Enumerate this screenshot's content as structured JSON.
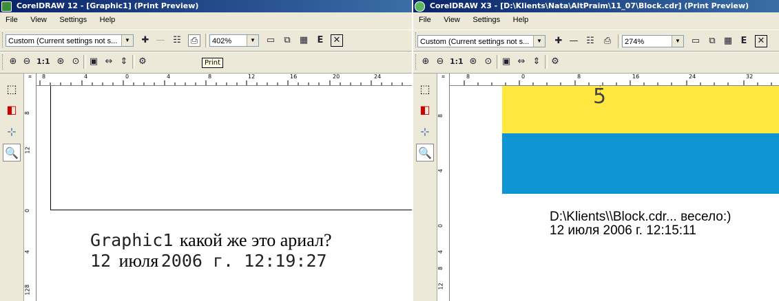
{
  "left": {
    "title": "CorelDRAW 12 - [Graphic1] (Print Preview)",
    "menu": [
      "File",
      "View",
      "Settings",
      "Help"
    ],
    "preset": "Custom (Current settings not s...",
    "zoom": "402%",
    "tooltip": "Print",
    "hruler_labels": [
      "8",
      "4",
      "0",
      "4",
      "8",
      "12",
      "16",
      "20",
      "24"
    ],
    "vruler_labels": [
      "8",
      "12",
      "0",
      "4",
      "8",
      "12"
    ],
    "footer_name": "Graphic1",
    "footer_comment": "какой же это ариал?",
    "footer_date_a": "12",
    "footer_date_b": "июля",
    "footer_date_c": "2006 г. 12:19:27"
  },
  "right": {
    "title": "CorelDRAW X3 - [D:\\Klients\\Nata\\AltPraim\\11_07\\Block.cdr] (Print Preview)",
    "menu": [
      "File",
      "View",
      "Settings",
      "Help"
    ],
    "preset": "Custom (Current settings not s...",
    "zoom": "274%",
    "hruler_labels": [
      "8",
      "0",
      "8",
      "16",
      "24",
      "32"
    ],
    "vruler_labels": [
      "8",
      "4",
      "0",
      "4",
      "8",
      "12"
    ],
    "marker": "5",
    "footer_line1": "D:\\Klients\\\\Block.cdr... весело:)",
    "footer_line2": "12 июля 2006 г. 12:15:11",
    "colors": {
      "yellow": "#ffe840",
      "blue": "#0f94d4"
    }
  },
  "icons": {
    "toolbar1": [
      "plus-icon",
      "minus-icon",
      "layout-icon",
      "print-icon",
      "save-icon",
      "copy-icon",
      "film-icon",
      "e-icon",
      "close-box-icon"
    ],
    "toolbar2": [
      "zoom-in-icon",
      "zoom-out-icon",
      "actual-size-icon",
      "zoom-all-icon",
      "zoom-selection-icon",
      "page-icon",
      "fit-width-icon",
      "fit-height-icon",
      "zoom-options-icon"
    ],
    "toolbox": [
      "pick-tool-icon",
      "imposition-tool-icon",
      "marks-tool-icon",
      "zoom-tool-icon"
    ]
  }
}
